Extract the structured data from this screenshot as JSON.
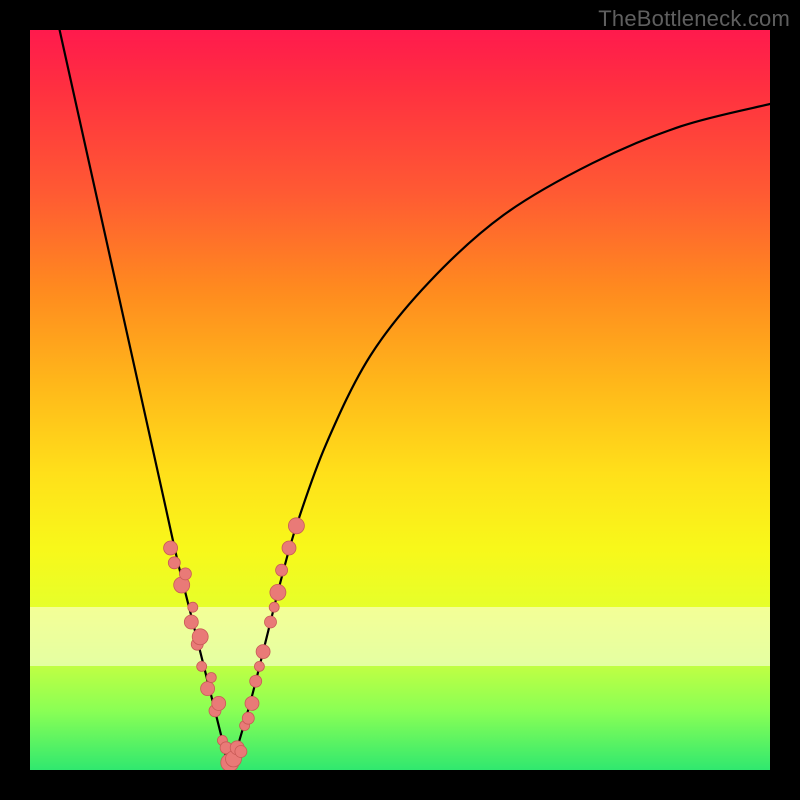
{
  "watermark": "TheBottleneck.com",
  "colors": {
    "accent_dot": "#e97a77",
    "curve": "#000000"
  },
  "chart_data": {
    "type": "line",
    "title": "",
    "xlabel": "",
    "ylabel": "",
    "xlim": [
      0,
      100
    ],
    "ylim": [
      0,
      100
    ],
    "pale_band_y": [
      78,
      86
    ],
    "note": "Bottleneck-style V-curve. y is bottleneck % (0 at bottom / green, 100 at top / red). X roughly proportional to relative GPU vs CPU performance. Curve minimum ~x=27. Values below are read off the plotted pixels.",
    "series": [
      {
        "name": "bottleneck-curve",
        "x": [
          4,
          8,
          12,
          16,
          18,
          20,
          22,
          24,
          26,
          27,
          28,
          30,
          32,
          34,
          36,
          40,
          46,
          54,
          64,
          76,
          88,
          100
        ],
        "y": [
          100,
          82,
          64,
          46,
          37,
          28,
          20,
          12,
          4,
          0,
          3,
          10,
          18,
          26,
          33,
          44,
          56,
          66,
          75,
          82,
          87,
          90
        ]
      }
    ],
    "points": {
      "name": "sample-dots",
      "note": "Salmon scatter points clustered around the curve near the bottom of the V.",
      "x": [
        19.0,
        19.5,
        20.5,
        21.0,
        21.8,
        22.0,
        22.6,
        23.0,
        23.2,
        24.0,
        24.5,
        25.0,
        25.5,
        26.0,
        26.5,
        27.0,
        27.5,
        28.0,
        28.5,
        29.0,
        29.5,
        30.0,
        30.5,
        31.0,
        31.5,
        32.5,
        33.0,
        33.5,
        34.0,
        35.0,
        36.0
      ],
      "y": [
        30.0,
        28.0,
        25.0,
        26.5,
        20.0,
        22.0,
        17.0,
        18.0,
        14.0,
        11.0,
        12.5,
        8.0,
        9.0,
        4.0,
        3.0,
        1.0,
        1.5,
        3.0,
        2.5,
        6.0,
        7.0,
        9.0,
        12.0,
        14.0,
        16.0,
        20.0,
        22.0,
        24.0,
        27.0,
        30.0,
        33.0
      ],
      "r": [
        7,
        6,
        8,
        6,
        7,
        5,
        6,
        8,
        5,
        7,
        5,
        6,
        7,
        5,
        6,
        9,
        8,
        7,
        6,
        5,
        6,
        7,
        6,
        5,
        7,
        6,
        5,
        8,
        6,
        7,
        8
      ]
    }
  }
}
